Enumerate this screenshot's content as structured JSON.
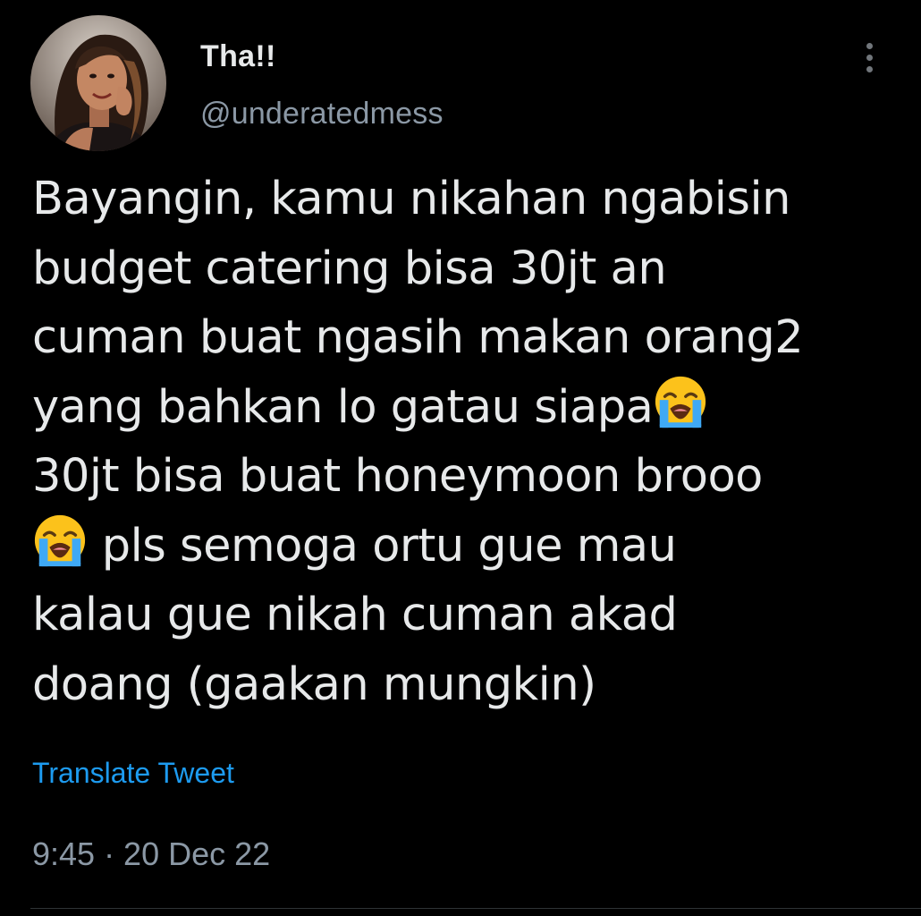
{
  "user": {
    "display_name": "Tha!!",
    "handle": "@underatedmess"
  },
  "tweet": {
    "line1": "Bayangin, kamu nikahan ngabisin",
    "line2": "budget catering bisa 30jt an",
    "line3": "cuman buat ngasih makan orang2",
    "line4": "yang bahkan lo gatau siapa",
    "line5": "30jt bisa buat honeymoon brooo",
    "line6": " pls semoga ortu gue mau",
    "line7": "kalau gue nikah cuman akad",
    "line8": "doang (gaakan mungkin)",
    "emoji_name": "loudly-crying-face"
  },
  "translate_label": "Translate Tweet",
  "timestamp": "9:45 · 20 Dec 22",
  "colors": {
    "background": "#000000",
    "text": "#e7e9ea",
    "secondary": "#8b98a5",
    "link": "#1d9bf0"
  }
}
